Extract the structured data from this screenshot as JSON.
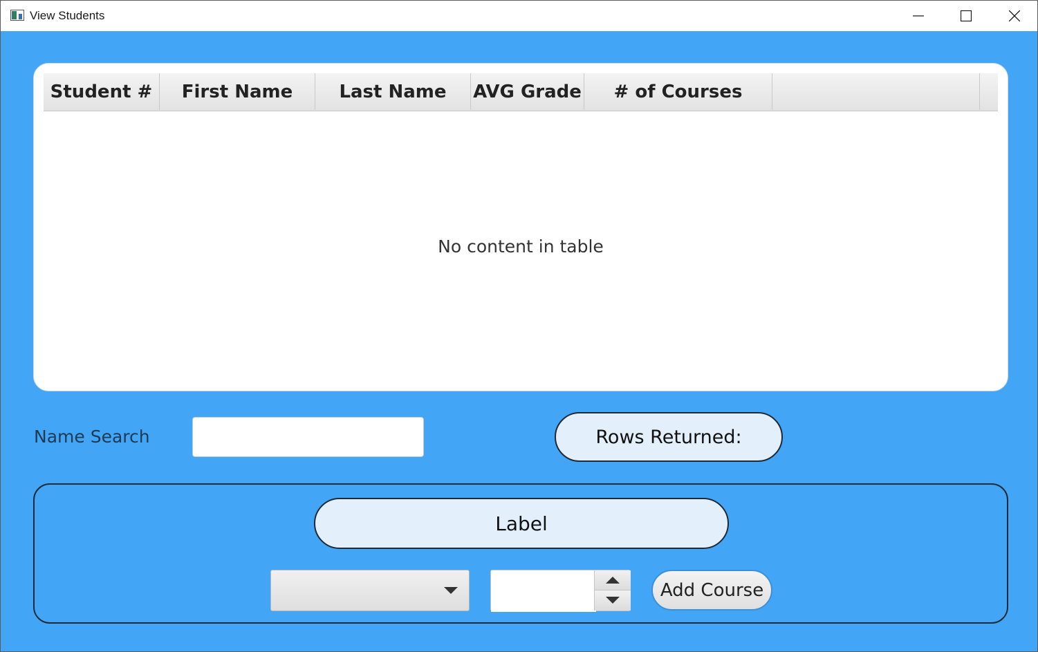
{
  "window": {
    "title": "View Students",
    "icon": "app-window-icon",
    "controls": [
      "minimize-icon",
      "maximize-icon",
      "close-icon"
    ]
  },
  "colors": {
    "background": "#42a5f5",
    "panel": "#ffffff",
    "label_fill": "#e3f0fb",
    "outline": "#1e2a36"
  },
  "table": {
    "columns": [
      "Student #",
      "First Name",
      "Last Name",
      "AVG Grade",
      "# of Courses"
    ],
    "rows": [],
    "placeholder": "No content in table"
  },
  "search": {
    "label": "Name Search",
    "value": ""
  },
  "rows_returned": {
    "label": "Rows Returned:"
  },
  "course_section": {
    "label": "Label",
    "combo_value": "",
    "spinner_value": "",
    "add_button": "Add Course"
  }
}
